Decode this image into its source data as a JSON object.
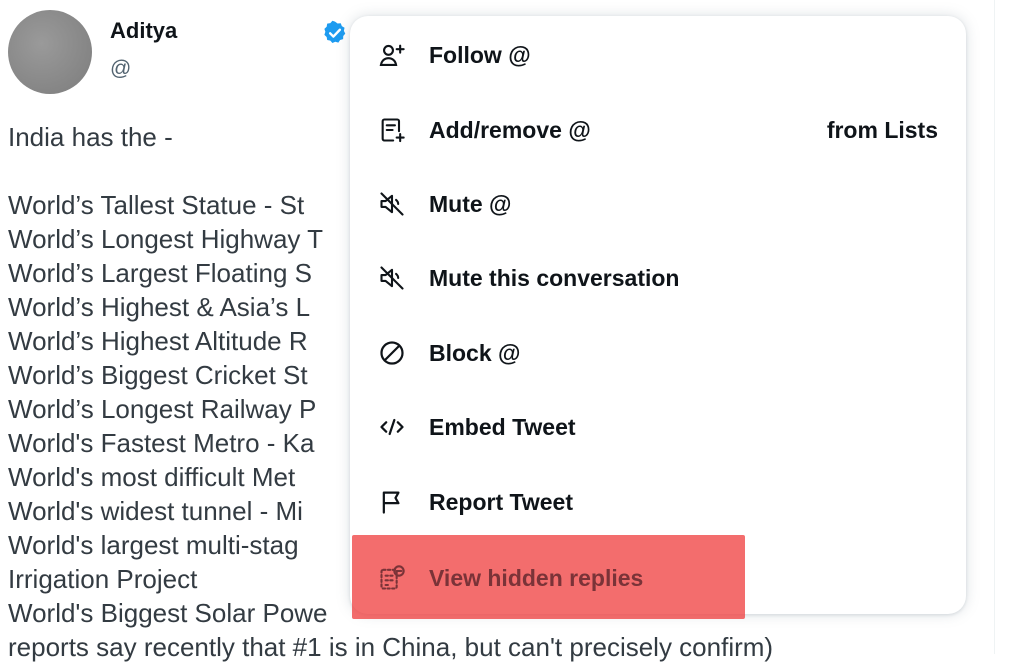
{
  "tweet": {
    "author_name": "Aditya",
    "handle": "@",
    "verified_icon": "verified-badge-icon",
    "lines": [
      "India has the -",
      "World’s Tallest Statue - St",
      "World’s Longest Highway T",
      "World’s Largest Floating S",
      "World’s Highest & Asia’s L",
      "World’s Highest Altitude R",
      "World’s Biggest Cricket St",
      "World’s Longest Railway P",
      "World's Fastest Metro - Ka",
      "World's most difficult Met",
      "World's widest tunnel - Mi",
      "World's largest multi-stag",
      "Irrigation Project",
      "World's Biggest Solar Powe",
      "reports say recently that #1 is in China, but can't precisely confirm)"
    ]
  },
  "menu": {
    "items": [
      {
        "label": "Follow @",
        "icon": "follow-user-icon"
      },
      {
        "label": "Add/remove @",
        "suffix": "from Lists",
        "icon": "list-add-icon"
      },
      {
        "label": "Mute @",
        "icon": "mute-speaker-icon"
      },
      {
        "label": "Mute this conversation",
        "icon": "mute-conversation-icon"
      },
      {
        "label": "Block @",
        "icon": "block-icon"
      },
      {
        "label": "Embed Tweet",
        "icon": "embed-code-icon"
      },
      {
        "label": "Report Tweet",
        "icon": "flag-icon"
      },
      {
        "label": "View hidden replies",
        "icon": "hidden-replies-icon"
      }
    ],
    "highlight_color": "#ef4444"
  }
}
